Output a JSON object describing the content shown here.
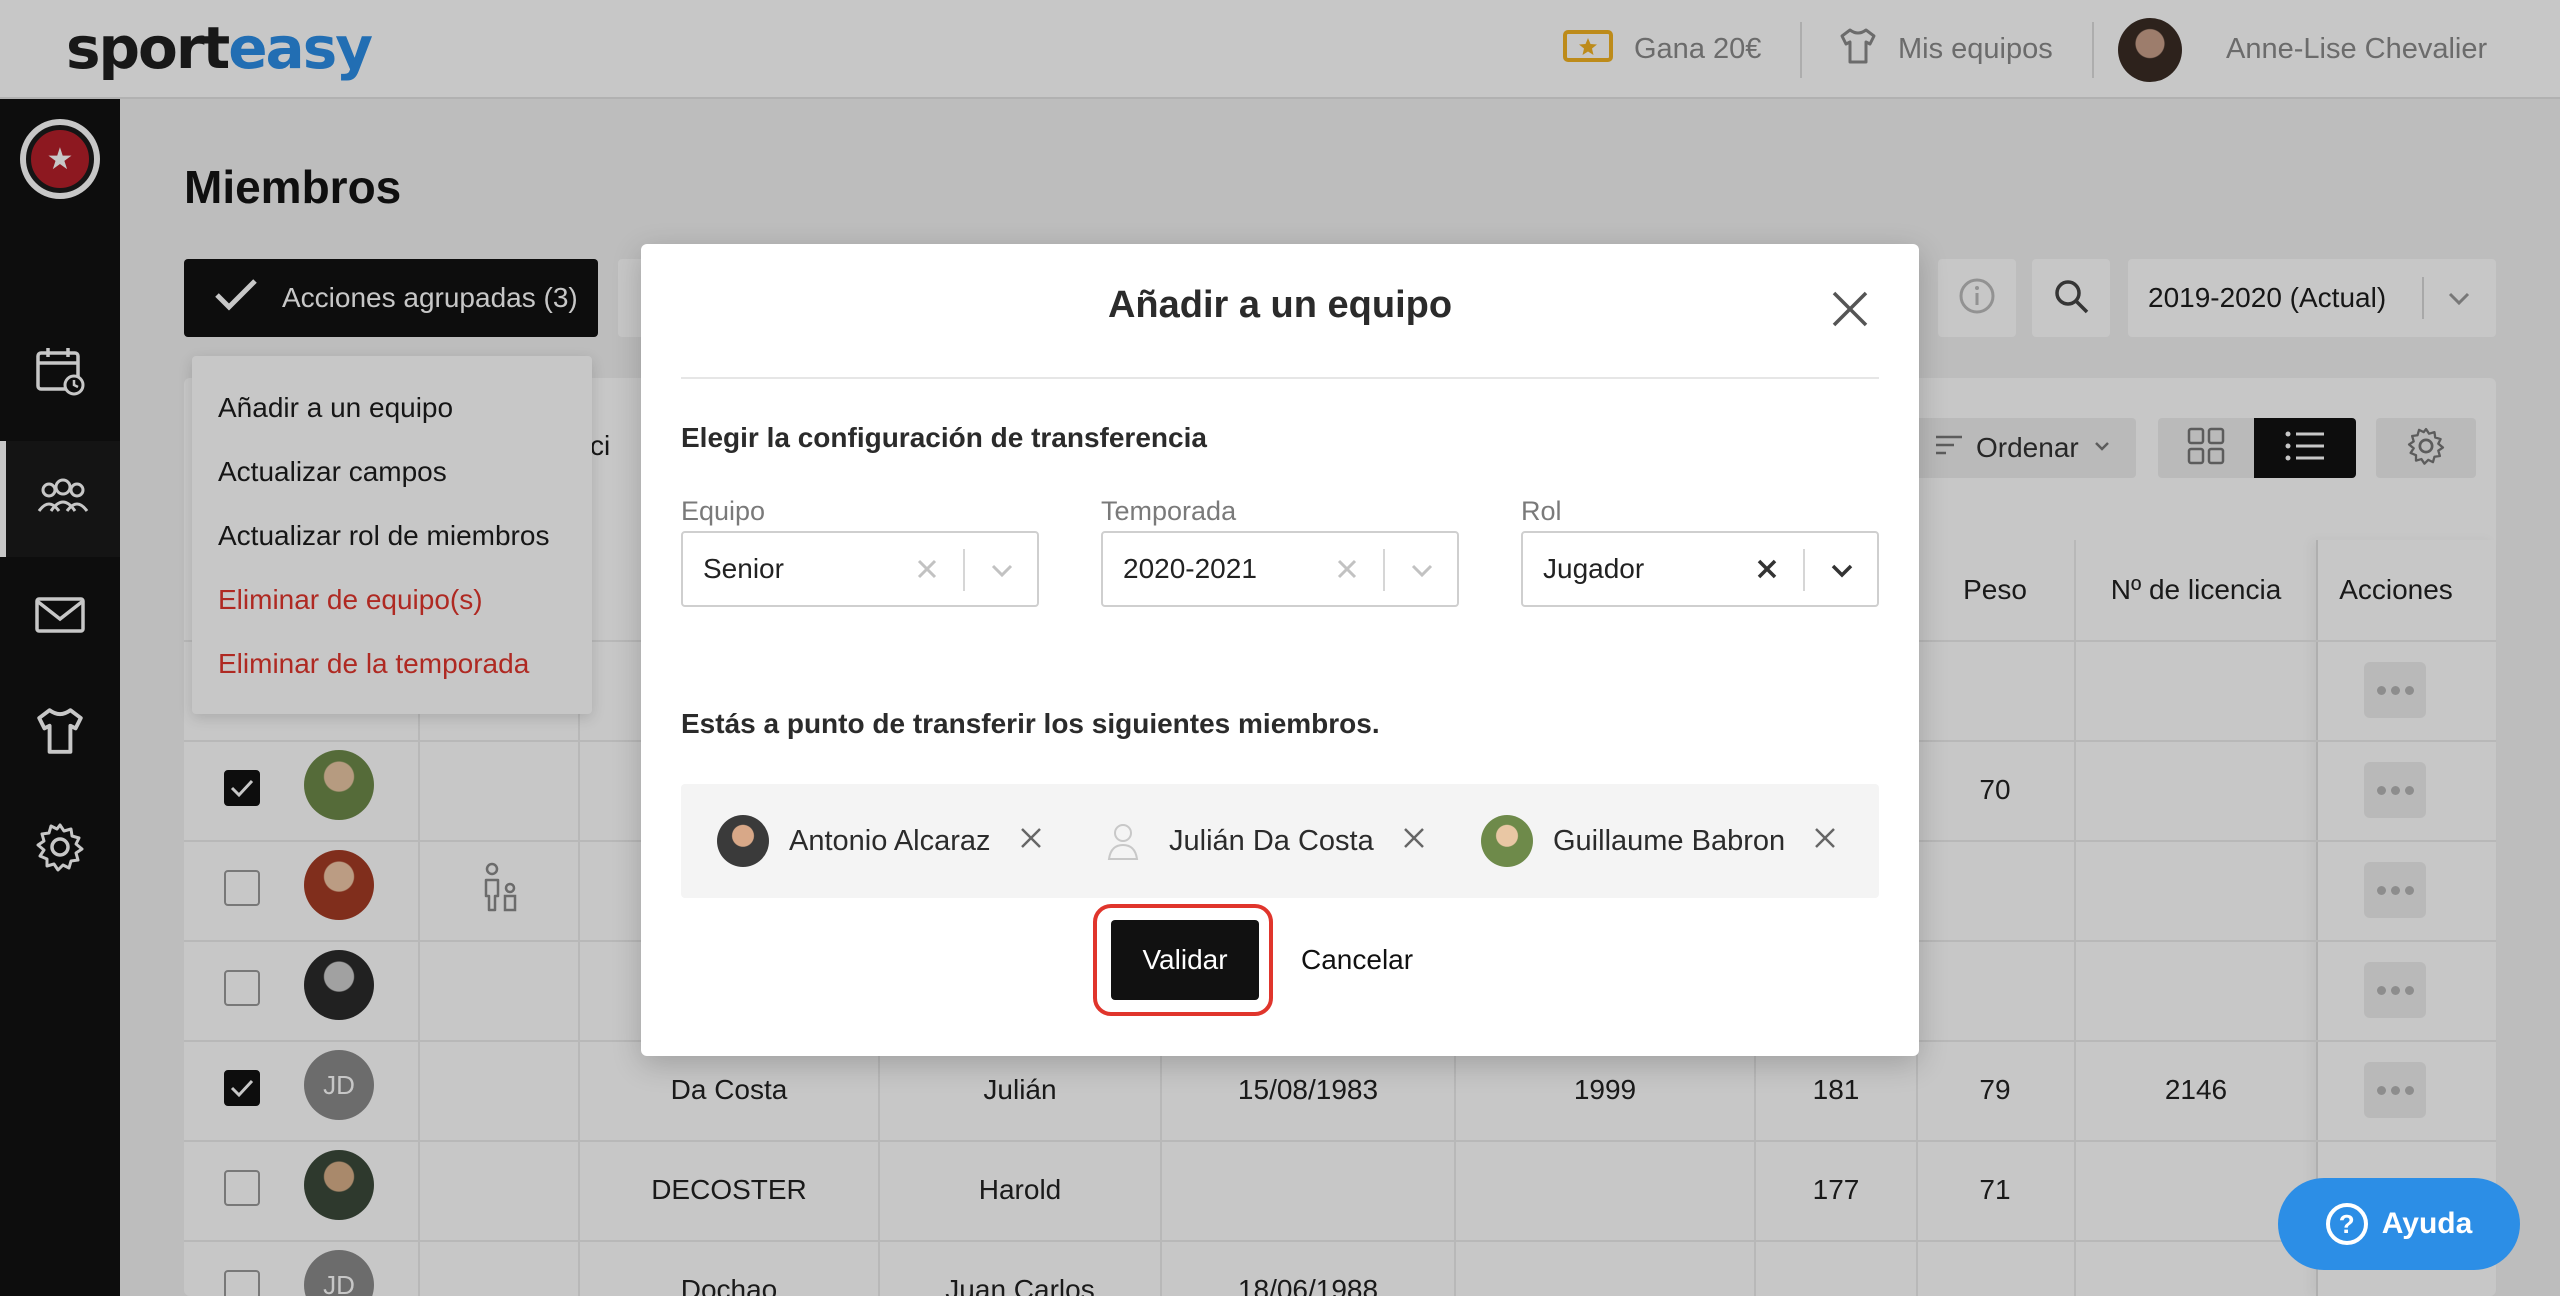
{
  "topbar": {
    "logo_part1": "sport",
    "logo_part2": "easy",
    "earn_label": "Gana 20€",
    "my_teams_label": "Mis equipos",
    "user_name": "Anne-Lise Chevalier"
  },
  "sidebar": {
    "items": [
      {
        "icon": "calendar-icon"
      },
      {
        "icon": "members-icon"
      },
      {
        "icon": "mail-icon"
      },
      {
        "icon": "jersey-icon"
      },
      {
        "icon": "gear-icon"
      }
    ]
  },
  "page": {
    "title": "Miembros",
    "bulk_actions_label": "Acciones agrupadas (3)",
    "season_select": "2019-2020 (Actual)",
    "sort_label": "Ordenar",
    "partial_label": "cci"
  },
  "bulk_menu": {
    "items": [
      {
        "label": "Añadir a un equipo"
      },
      {
        "label": "Actualizar campos"
      },
      {
        "label": "Actualizar rol de miembros"
      },
      {
        "label": "Eliminar de equipo(s)"
      },
      {
        "label": "Eliminar de la temporada"
      }
    ]
  },
  "table": {
    "headers": {
      "weight": "Peso",
      "license": "Nº de licencia",
      "actions": "Acciones"
    },
    "rows": [
      {
        "checked": true,
        "weight": "70"
      },
      {
        "checked": false
      },
      {
        "checked": false
      },
      {
        "checked": true,
        "initials": "JD",
        "last_name": "Da Costa",
        "first_name": "Julián",
        "birth_date": "15/08/1983",
        "year": "1999",
        "height": "181",
        "weight": "79",
        "license": "2146"
      },
      {
        "checked": false,
        "last_name": "DECOSTER",
        "first_name": "Harold",
        "height": "177",
        "weight": "71"
      },
      {
        "checked": false,
        "initials": "JD",
        "last_name": "Dochao",
        "first_name": "Juan Carlos",
        "birth_date": "18/06/1988"
      }
    ]
  },
  "modal": {
    "title": "Añadir a un equipo",
    "transfer_config_title": "Elegir la configuración de transferencia",
    "team_label": "Equipo",
    "team_value": "Senior",
    "season_label": "Temporada",
    "season_value": "2020-2021",
    "role_label": "Rol",
    "role_value": "Jugador",
    "members_intro": "Estás a punto de transferir los siguientes miembros.",
    "members": [
      {
        "name": "Antonio Alcaraz"
      },
      {
        "name": "Julián Da Costa"
      },
      {
        "name": "Guillaume Babron"
      }
    ],
    "validate_label": "Validar",
    "cancel_label": "Cancelar"
  },
  "help": {
    "label": "Ayuda"
  },
  "colors": {
    "brand_blue": "#2c8ee6",
    "danger_red": "#e0352c",
    "dark": "#111111"
  }
}
